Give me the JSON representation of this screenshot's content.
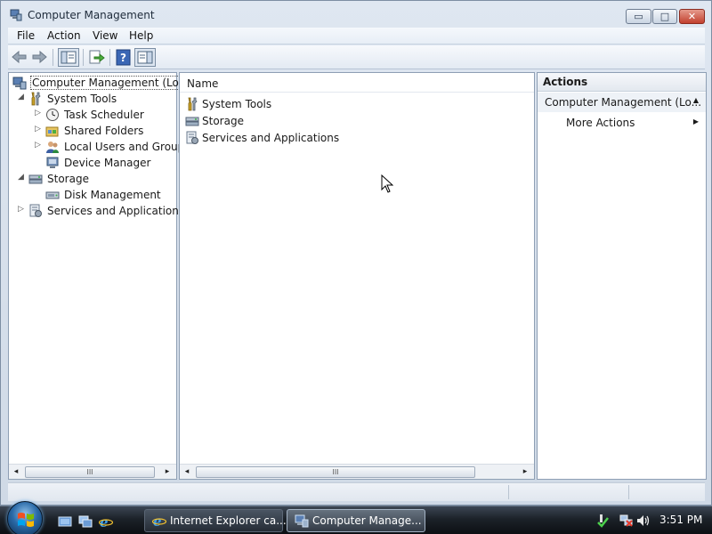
{
  "window": {
    "title": "Computer Management",
    "min_glyph": "▭",
    "max_glyph": "□",
    "close_glyph": "✕"
  },
  "menu": {
    "items": [
      "File",
      "Action",
      "View",
      "Help"
    ]
  },
  "toolbar": {
    "buttons": [
      "back-icon",
      "forward-icon",
      "show-hide-console-tree-icon",
      "export-list-icon",
      "help-icon",
      "show-hide-action-pane-icon"
    ]
  },
  "tree": {
    "root": "Computer Management (Local",
    "items": [
      {
        "label": "System Tools",
        "expanded": true,
        "icon": "tools-icon"
      },
      {
        "label": "Task Scheduler",
        "expanded": false,
        "icon": "clock-icon"
      },
      {
        "label": "Shared Folders",
        "expanded": false,
        "icon": "shared-folders-icon"
      },
      {
        "label": "Local Users and Groups",
        "expanded": false,
        "icon": "users-icon"
      },
      {
        "label": "Device Manager",
        "icon": "device-manager-icon"
      },
      {
        "label": "Storage",
        "expanded": true,
        "icon": "storage-icon"
      },
      {
        "label": "Disk Management",
        "icon": "disk-icon"
      },
      {
        "label": "Services and Applications",
        "expanded": false,
        "icon": "services-icon"
      }
    ]
  },
  "list": {
    "header": "Name",
    "items": [
      "System Tools",
      "Storage",
      "Services and Applications"
    ]
  },
  "actions": {
    "header": "Actions",
    "group": "Computer Management (Lo...",
    "more": "More Actions"
  },
  "scroll": {
    "grip": "III"
  },
  "taskbar": {
    "tasks": [
      "Internet Explorer ca...",
      "Computer Manage..."
    ],
    "clock": "3:51 PM"
  },
  "colors": {
    "accent": "#2a6aa8",
    "taskbar": "#1c2229",
    "selection_dotted": "#555555"
  }
}
